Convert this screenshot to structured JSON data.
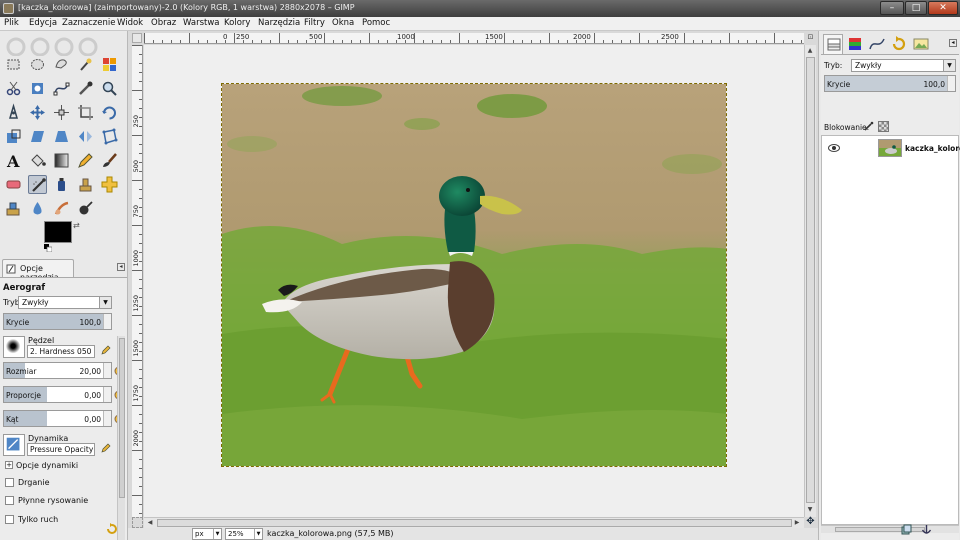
{
  "window": {
    "title": "[kaczka_kolorowa] (zaimportowany)-2.0 (Kolory RGB, 1 warstwa) 2880x2078 – GIMP"
  },
  "menu": {
    "items": [
      "Plik",
      "Edycja",
      "Zaznaczenie",
      "Widok",
      "Obraz",
      "Warstwa",
      "Kolory",
      "Narzędzia",
      "Filtry",
      "Okna",
      "Pomoc"
    ]
  },
  "toolbox": {
    "foreground_color": "#000000",
    "background_color": "#ffffff",
    "active_tool": "airbrush"
  },
  "tool_options": {
    "tab_label": "Opcje narzędzia",
    "heading": "Aerograf",
    "mode_label": "Tryb:",
    "mode_value": "Zwykły",
    "opacity_label": "Krycie",
    "opacity_value": "100,0",
    "opacity_fraction": 1.0,
    "brush_label": "Pędzel",
    "brush_value": "2. Hardness 050",
    "size_label": "Rozmiar",
    "size_value": "20,00",
    "size_fraction": 0.2,
    "aspect_label": "Proporcje",
    "aspect_value": "0,00",
    "aspect_fraction": 0.4,
    "angle_label": "Kąt",
    "angle_value": "0,00",
    "angle_fraction": 0.4,
    "dynamics_label": "Dynamika",
    "dynamics_value": "Pressure Opacity",
    "dynamics_options_label": "Opcje dynamiki",
    "jitter_label": "Drganie",
    "smooth_label": "Płynne rysowanie",
    "motion_only_label": "Tylko ruch"
  },
  "rulers": {
    "horizontal": [
      "0",
      "250",
      "500",
      "1000",
      "1500",
      "2000",
      "2500"
    ],
    "vertical": [
      "250",
      "500",
      "750",
      "1000",
      "1250",
      "1500",
      "1750",
      "2000"
    ]
  },
  "status": {
    "unit": "px",
    "zoom": "25%",
    "file_info": "kaczka_kolorowa.png (57,5 MB)"
  },
  "layers_panel": {
    "mode_label": "Tryb:",
    "mode_value": "Zwykły",
    "opacity_label": "Krycie",
    "opacity_value": "100,0",
    "lock_label": "Blokowanie:",
    "layers": [
      {
        "name": "kaczka_kolorowa",
        "visible": true
      }
    ]
  },
  "colors": {
    "selection_border": "#7d6a00",
    "slider_fill": "#b9c3ce"
  }
}
